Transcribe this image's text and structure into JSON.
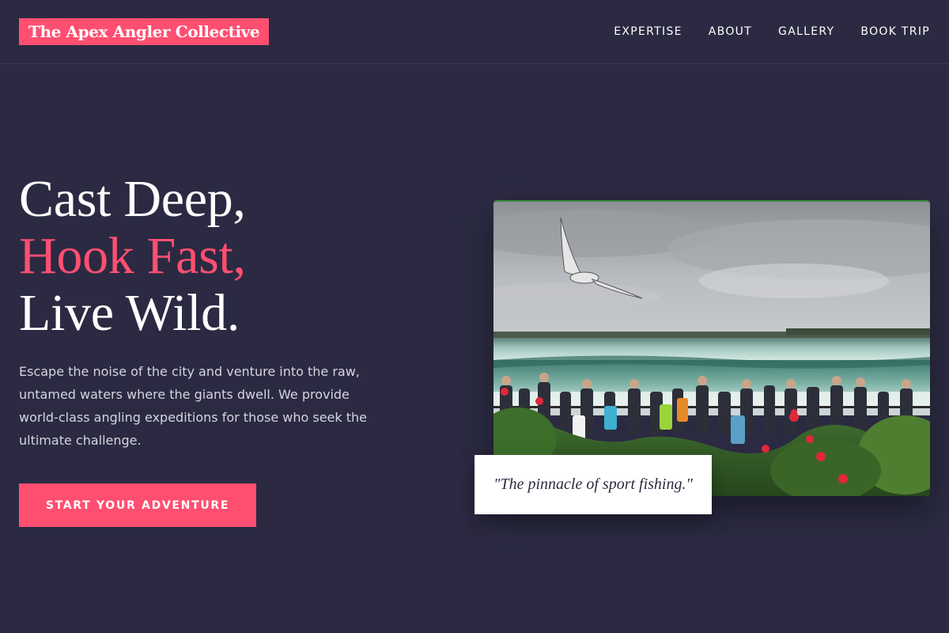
{
  "header": {
    "brand": "The Apex Angler Collective",
    "nav": [
      {
        "label": "EXPERTISE"
      },
      {
        "label": "ABOUT"
      },
      {
        "label": "GALLERY"
      },
      {
        "label": "BOOK TRIP"
      }
    ]
  },
  "hero": {
    "title_line1": "Cast Deep,",
    "title_line2": "Hook Fast,",
    "title_line3": "Live Wild.",
    "description": "Escape the noise of the city and venture into the raw, untamed waters where the giants dwell. We provide world-class angling expeditions for those who seek the ultimate challenge.",
    "cta_label": "START YOUR ADVENTURE"
  },
  "photo": {
    "quote": "\"The pinnacle of sport fishing.\""
  },
  "colors": {
    "background": "#2b2a42",
    "accent": "#ff4f71",
    "text": "#ffffff",
    "muted_text": "#d5d4de"
  }
}
